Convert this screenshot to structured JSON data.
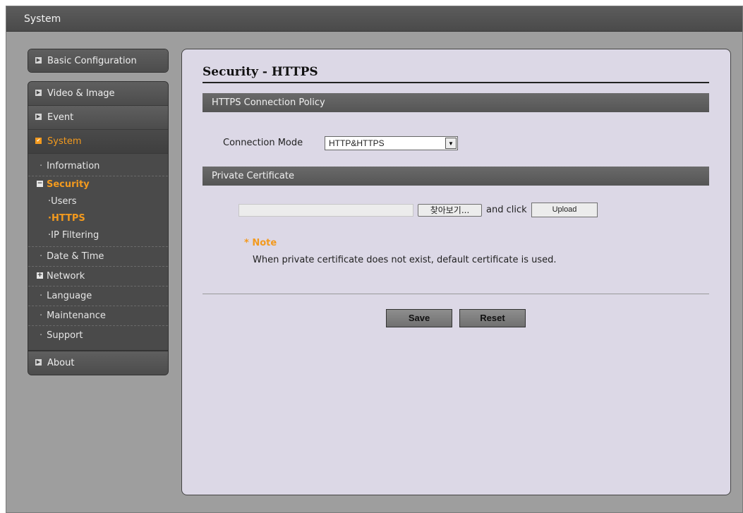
{
  "window": {
    "title": "System"
  },
  "sidebar": {
    "basic_configuration": "Basic Configuration",
    "video_image": "Video & Image",
    "event": "Event",
    "system": "System",
    "system_sub": {
      "information": "Information",
      "security": "Security",
      "users": "Users",
      "https": "HTTPS",
      "ip_filtering": "IP Filtering",
      "date_time": "Date & Time",
      "network": "Network",
      "language": "Language",
      "maintenance": "Maintenance",
      "support": "Support"
    },
    "about": "About"
  },
  "main": {
    "title": "Security - HTTPS",
    "policy_section": "HTTPS Connection Policy",
    "connection_mode_label": "Connection Mode",
    "connection_mode_value": "HTTP&HTTPS",
    "cert_section": "Private Certificate",
    "browse_label": "찾아보기...",
    "and_click": "and click",
    "upload_label": "Upload",
    "note_title": "* Note",
    "note_text": "When private certificate does not exist, default certificate is used.",
    "save_label": "Save",
    "reset_label": "Reset"
  },
  "colors": {
    "accent": "#f39a1e",
    "panel_bg": "#dcd8e6",
    "sidebar_bg": "#555555"
  },
  "icons": {
    "collapsed": "play-arrow-icon",
    "expanded": "check-box-icon",
    "minus": "minus-box-icon",
    "plus": "plus-box-icon"
  }
}
